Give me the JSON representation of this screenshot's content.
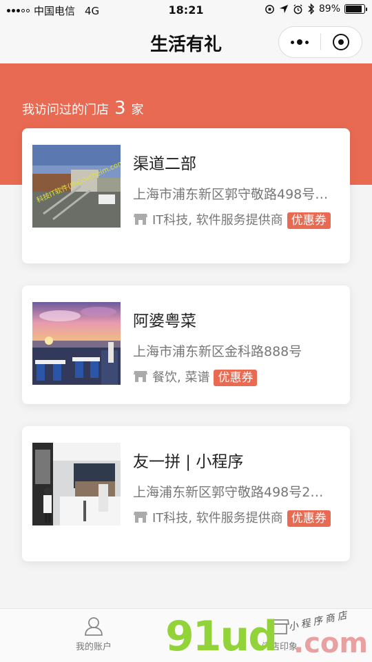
{
  "status_bar": {
    "carrier": "中国电信",
    "network": "4G",
    "time": "18:21",
    "battery": "89%",
    "battery_level": 0.89
  },
  "nav": {
    "title": "生活有礼"
  },
  "banner": {
    "visited_prefix": "我访问过的门店",
    "visited_count": "3",
    "visited_suffix": "家",
    "color": "#e96a52"
  },
  "stores": [
    {
      "name": "渠道二部",
      "address": "上海市浦东新区郭守敬路498号…",
      "category": "IT科技, 软件服务提供商",
      "badge": "优惠券",
      "image_overlay_text": "科技IT软件(中心)vcheim.com"
    },
    {
      "name": "阿婆粤菜",
      "address": "上海市浦东新区金科路888号",
      "category": "餐饮, 菜谱",
      "badge": "优惠券"
    },
    {
      "name": "友一拼 | 小程序",
      "address": "上海浦东新区郭守敬路498号2…",
      "category": "IT科技, 软件服务提供商",
      "badge": "优惠券"
    }
  ],
  "tabs": [
    {
      "label": "我的账户",
      "icon": "user-icon"
    },
    {
      "label": "门店印象",
      "icon": "store-icon"
    }
  ],
  "watermark": {
    "main": "91ud",
    "tld": ".com",
    "slogan": "小程序商店"
  }
}
